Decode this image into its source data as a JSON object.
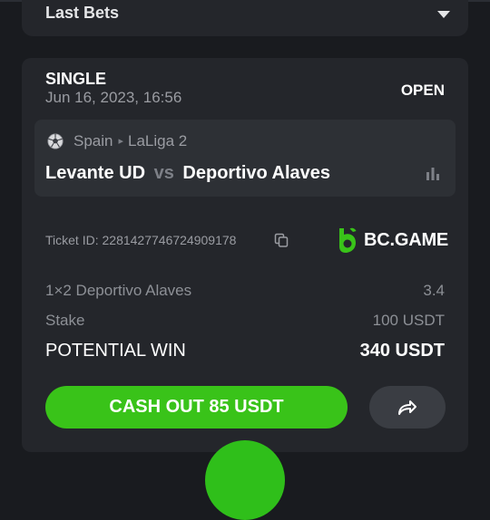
{
  "last_bets": {
    "label": "Last Bets"
  },
  "bet": {
    "type": "SINGLE",
    "date": "Jun 16, 2023, 16:56",
    "status": "OPEN",
    "sport_icon": "soccer-ball-icon",
    "country": "Spain",
    "league": "LaLiga 2",
    "home_team": "Levante UD",
    "vs": "vs",
    "away_team": "Deportivo Alaves",
    "ticket_label": "Ticket ID:",
    "ticket_id": "2281427746724909178",
    "brand": "BC.GAME",
    "selection": "1×2 Deportivo Alaves",
    "odds": "3.4",
    "stake_label": "Stake",
    "stake_value": "100 USDT",
    "potential_label": "POTENTIAL WIN",
    "potential_value": "340 USDT",
    "cashout_label": "CASH OUT 85 USDT"
  },
  "colors": {
    "background": "#191b1f",
    "card": "#24262b",
    "match_box": "#2d3035",
    "accent_green": "#39c319",
    "muted_text": "#9a9ca2"
  }
}
